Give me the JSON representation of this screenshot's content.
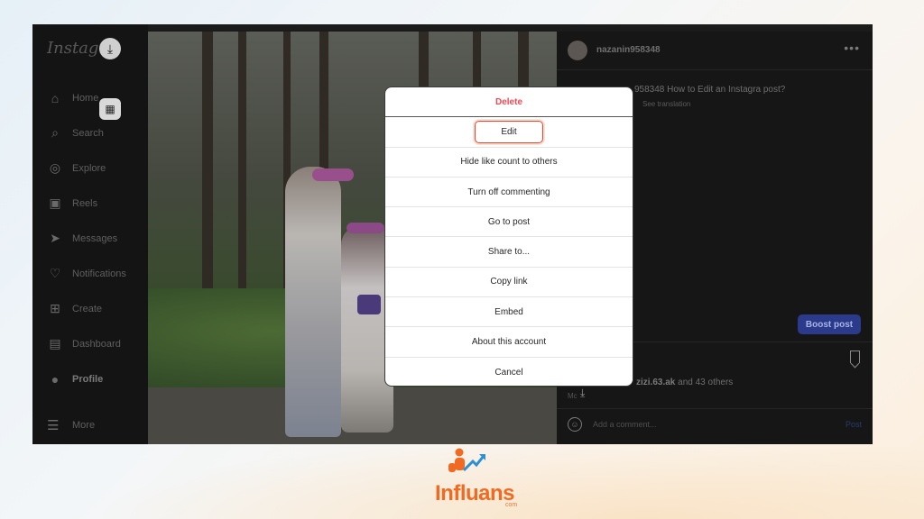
{
  "sidebar": {
    "logo": "Instagra",
    "items": [
      {
        "label": "Home",
        "icon": "home-icon",
        "glyph": "⌂"
      },
      {
        "label": "Search",
        "icon": "search-icon",
        "glyph": "⌕"
      },
      {
        "label": "Explore",
        "icon": "compass-icon",
        "glyph": "◎"
      },
      {
        "label": "Reels",
        "icon": "reels-icon",
        "glyph": "▣"
      },
      {
        "label": "Messages",
        "icon": "messages-icon",
        "glyph": "➤"
      },
      {
        "label": "Notifications",
        "icon": "heart-icon",
        "glyph": "♡"
      },
      {
        "label": "Create",
        "icon": "plus-icon",
        "glyph": "⊞"
      },
      {
        "label": "Dashboard",
        "icon": "dashboard-icon",
        "glyph": "▤"
      },
      {
        "label": "Profile",
        "icon": "avatar-icon",
        "glyph": "●"
      }
    ],
    "more": "More"
  },
  "post": {
    "username": "nazanin958348",
    "more_glyph": "•••",
    "caption": "958348 How to Edit an Instagra post?",
    "see_translation": "See translation",
    "boost_label": "Boost post",
    "likes_user": "zizi.63.ak",
    "likes_rest": " and 43 others",
    "mo": "Mc",
    "comment_placeholder": "Add a comment...",
    "post_label": "Post"
  },
  "modal": {
    "items": [
      {
        "label": "Delete",
        "kind": "danger"
      },
      {
        "label": "Edit",
        "kind": "highlighted"
      },
      {
        "label": "Hide like count to others"
      },
      {
        "label": "Turn off commenting"
      },
      {
        "label": "Go to post"
      },
      {
        "label": "Share to..."
      },
      {
        "label": "Copy link"
      },
      {
        "label": "Embed"
      },
      {
        "label": "About this account"
      },
      {
        "label": "Cancel"
      }
    ]
  },
  "brand": {
    "name": "Influans",
    "suffix": "com",
    "color": "#f26a21"
  },
  "colors": {
    "delete": "#ed4956",
    "highlight_border": "#e0452c",
    "boost": "#2b3a8a"
  }
}
